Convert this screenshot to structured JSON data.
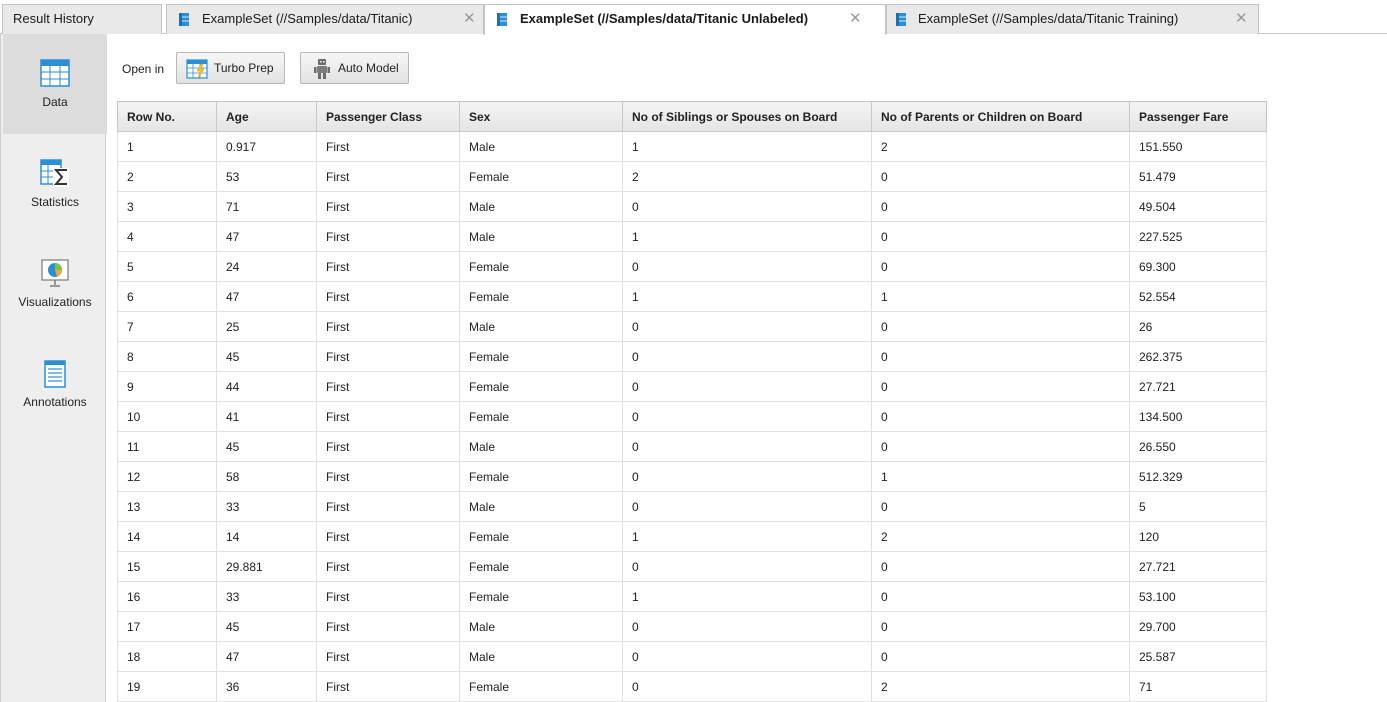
{
  "tabs": [
    {
      "label": "Result History",
      "active": false,
      "icon": "none",
      "closable": false
    },
    {
      "label": "ExampleSet (//Samples/data/Titanic)",
      "active": false,
      "icon": "exampleset-icon",
      "closable": true
    },
    {
      "label": "ExampleSet (//Samples/data/Titanic Unlabeled)",
      "active": true,
      "icon": "exampleset-icon",
      "closable": true
    },
    {
      "label": "ExampleSet (//Samples/data/Titanic Training)",
      "active": false,
      "icon": "exampleset-icon",
      "closable": true
    }
  ],
  "tab_close_glyph": "✕",
  "sidebar": {
    "items": [
      {
        "label": "Data",
        "icon": "data-table-icon",
        "active": true
      },
      {
        "label": "Statistics",
        "icon": "statistics-sigma-icon",
        "active": false
      },
      {
        "label": "Visualizations",
        "icon": "visualizations-chart-icon",
        "active": false
      },
      {
        "label": "Annotations",
        "icon": "annotations-notepad-icon",
        "active": false
      }
    ]
  },
  "toolbar": {
    "open_in_label": "Open in",
    "turbo_prep_label": "Turbo Prep",
    "auto_model_label": "Auto Model"
  },
  "table": {
    "columns": [
      "Row No.",
      "Age",
      "Passenger Class",
      "Sex",
      "No of Siblings or Spouses on Board",
      "No of Parents or Children on Board",
      "Passenger Fare"
    ],
    "rows": [
      [
        "1",
        "0.917",
        "First",
        "Male",
        "1",
        "2",
        "151.550"
      ],
      [
        "2",
        "53",
        "First",
        "Female",
        "2",
        "0",
        "51.479"
      ],
      [
        "3",
        "71",
        "First",
        "Male",
        "0",
        "0",
        "49.504"
      ],
      [
        "4",
        "47",
        "First",
        "Male",
        "1",
        "0",
        "227.525"
      ],
      [
        "5",
        "24",
        "First",
        "Female",
        "0",
        "0",
        "69.300"
      ],
      [
        "6",
        "47",
        "First",
        "Female",
        "1",
        "1",
        "52.554"
      ],
      [
        "7",
        "25",
        "First",
        "Male",
        "0",
        "0",
        "26"
      ],
      [
        "8",
        "45",
        "First",
        "Female",
        "0",
        "0",
        "262.375"
      ],
      [
        "9",
        "44",
        "First",
        "Female",
        "0",
        "0",
        "27.721"
      ],
      [
        "10",
        "41",
        "First",
        "Female",
        "0",
        "0",
        "134.500"
      ],
      [
        "11",
        "45",
        "First",
        "Male",
        "0",
        "0",
        "26.550"
      ],
      [
        "12",
        "58",
        "First",
        "Female",
        "0",
        "1",
        "512.329"
      ],
      [
        "13",
        "33",
        "First",
        "Male",
        "0",
        "0",
        "5"
      ],
      [
        "14",
        "14",
        "First",
        "Female",
        "1",
        "2",
        "120"
      ],
      [
        "15",
        "29.881",
        "First",
        "Female",
        "0",
        "0",
        "27.721"
      ],
      [
        "16",
        "33",
        "First",
        "Female",
        "1",
        "0",
        "53.100"
      ],
      [
        "17",
        "45",
        "First",
        "Male",
        "0",
        "0",
        "29.700"
      ],
      [
        "18",
        "47",
        "First",
        "Male",
        "0",
        "0",
        "25.587"
      ],
      [
        "19",
        "36",
        "First",
        "Female",
        "0",
        "2",
        "71"
      ]
    ]
  },
  "colors": {
    "accent_blue": "#2b8fd6",
    "active_tab_bg": "#ffffff",
    "inactive_tab_bg": "#e9e9e9",
    "sidebar_bg": "#eeeeee",
    "sidebar_active_bg": "#dcdcdc",
    "header_bg": "#e8e8e8"
  }
}
